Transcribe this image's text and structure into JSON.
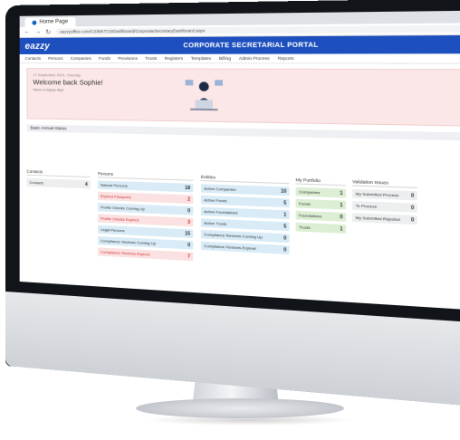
{
  "browser": {
    "tab_title": "Home Page",
    "url": "eazzyoffice.com/CS/MKTCS/Dashboard/CorporateSecretaryDashboard.aspx"
  },
  "app": {
    "logo": "eazzy",
    "portal_title": "CORPORATE SECRETARIAL PORTAL",
    "menu": [
      "Contacts",
      "Persons",
      "Companies",
      "Funds",
      "Provisions",
      "Trusts",
      "Registers",
      "Templates",
      "Billing",
      "Admin Process",
      "Reports"
    ],
    "brand_color": "#1d4fbf"
  },
  "banner": {
    "date": "17 September 2021, Tuesday",
    "welcome": "Welcome back Sophie!",
    "sub": "Have a Happy day!"
  },
  "section_title": "Basic Annual Status",
  "panels": {
    "contacts": {
      "title": "Contacts",
      "rows": [
        {
          "label": "Contacts",
          "value": "4",
          "tone": "grey"
        }
      ]
    },
    "persons": {
      "title": "Persons",
      "rows": [
        {
          "label": "Natural Persons",
          "value": "18",
          "tone": "blue"
        },
        {
          "label": "Expired Passports",
          "value": "2",
          "tone": "red"
        },
        {
          "label": "Profile Checks Coming Up",
          "value": "0",
          "tone": "blue"
        },
        {
          "label": "Profile Checks Expired",
          "value": "3",
          "tone": "red"
        },
        {
          "label": "Legal Persons",
          "value": "15",
          "tone": "blue"
        },
        {
          "label": "Compliance Reviews Coming Up",
          "value": "0",
          "tone": "blue"
        },
        {
          "label": "Compliance Reviews Expired",
          "value": "7",
          "tone": "red"
        }
      ]
    },
    "entities": {
      "title": "Entities",
      "rows": [
        {
          "label": "Active Companies",
          "value": "10",
          "tone": "blue"
        },
        {
          "label": "Active Funds",
          "value": "5",
          "tone": "blue"
        },
        {
          "label": "Active Foundations",
          "value": "1",
          "tone": "blue"
        },
        {
          "label": "Active Trusts",
          "value": "5",
          "tone": "blue"
        },
        {
          "label": "Compliance Reviews Coming Up",
          "value": "0",
          "tone": "blue"
        },
        {
          "label": "Compliance Reviews Expired",
          "value": "0",
          "tone": "blue"
        }
      ]
    },
    "my_portfolio": {
      "title": "My Portfolio",
      "rows": [
        {
          "label": "Companies",
          "value": "1",
          "tone": "green"
        },
        {
          "label": "Funds",
          "value": "1",
          "tone": "green"
        },
        {
          "label": "Foundations",
          "value": "0",
          "tone": "green"
        },
        {
          "label": "Trusts",
          "value": "1",
          "tone": "green"
        }
      ]
    },
    "validation_issues": {
      "title": "Validation Issues",
      "rows": [
        {
          "label": "My Submitted Process",
          "value": "0",
          "tone": "grey"
        },
        {
          "label": "To Process",
          "value": "0",
          "tone": "grey"
        },
        {
          "label": "My Submitted Rejected",
          "value": "0",
          "tone": "grey"
        }
      ]
    }
  }
}
